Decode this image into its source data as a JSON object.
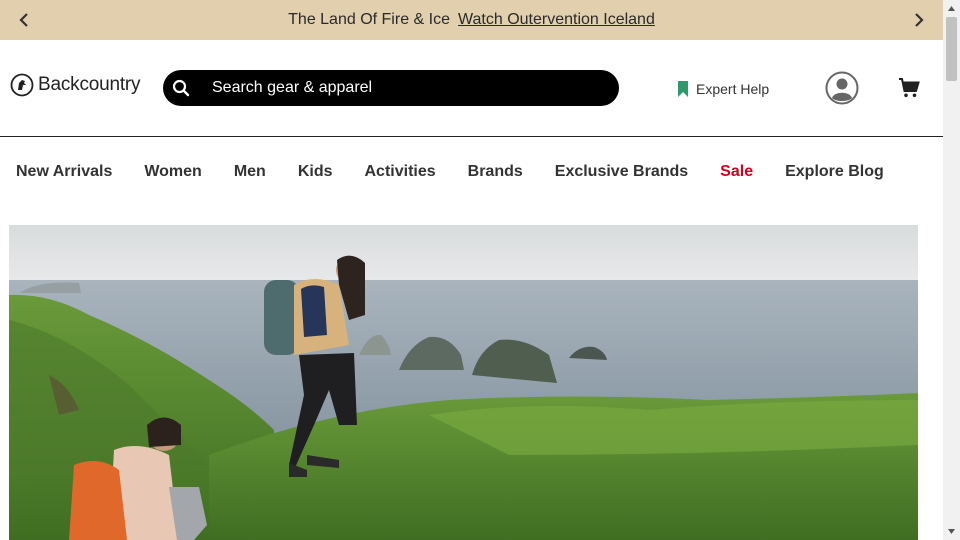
{
  "promo": {
    "text": "The Land Of Fire & Ice",
    "link_text": "Watch Outervention Iceland",
    "prev_icon": "chevron-left-icon",
    "next_icon": "chevron-right-icon",
    "background": "#e1cfad"
  },
  "header": {
    "logo_text": "Backcountry",
    "logo_icon": "goat-logo-icon",
    "search": {
      "placeholder": "Search gear & apparel",
      "value": "",
      "icon": "search-icon"
    },
    "expert_help": {
      "label": "Expert Help",
      "icon": "bookmark-icon",
      "icon_color": "#2e9a6b"
    },
    "account_icon": "user-avatar-icon",
    "cart_icon": "cart-icon"
  },
  "nav": {
    "items": [
      {
        "label": "New Arrivals"
      },
      {
        "label": "Women"
      },
      {
        "label": "Men"
      },
      {
        "label": "Kids"
      },
      {
        "label": "Activities"
      },
      {
        "label": "Brands"
      },
      {
        "label": "Exclusive Brands"
      },
      {
        "label": "Sale",
        "color": "#d0021b"
      },
      {
        "label": "Explore Blog"
      }
    ]
  },
  "hero": {
    "image": "hikers-on-green-cliff-above-ocean"
  }
}
